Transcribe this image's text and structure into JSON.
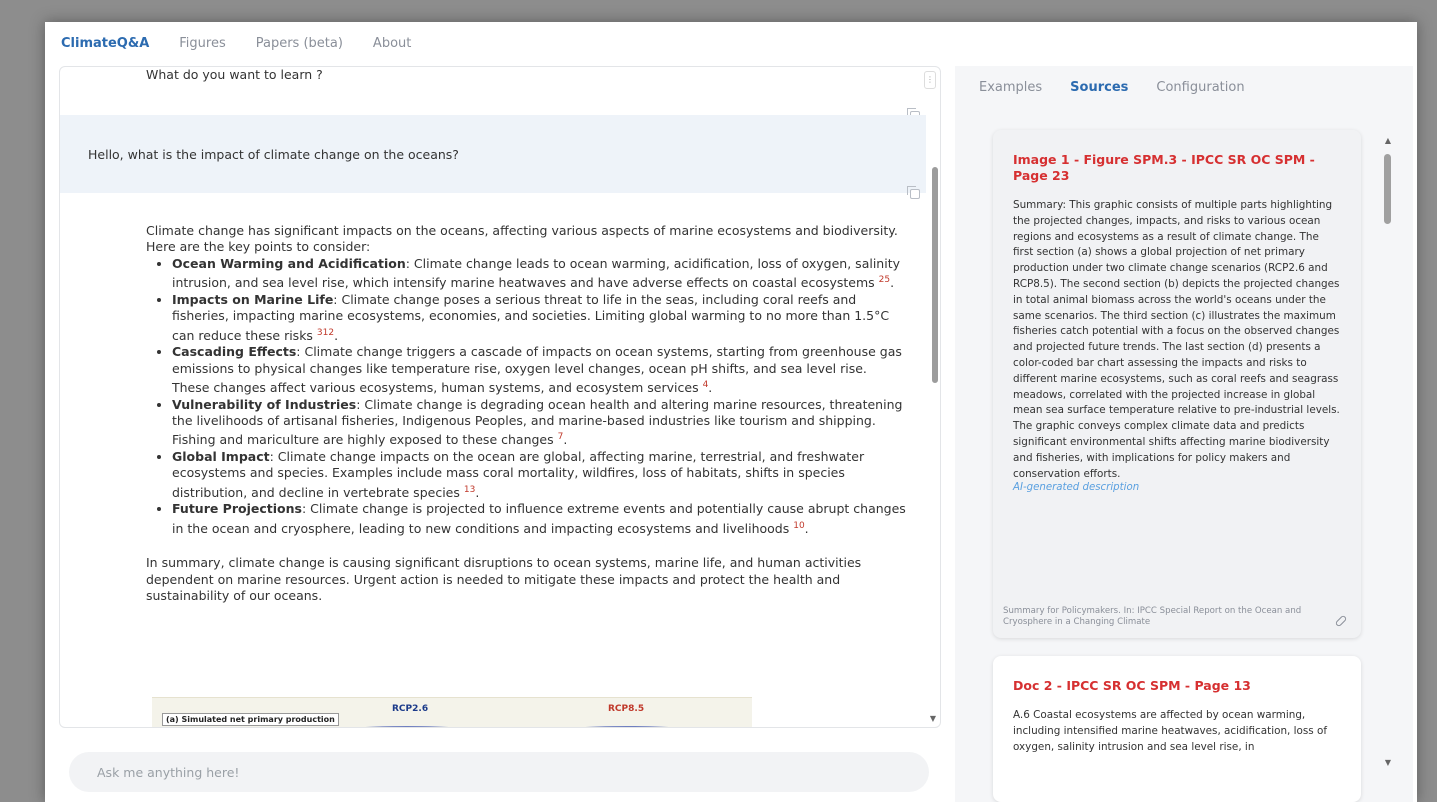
{
  "nav": {
    "items": [
      "ClimateQ&A",
      "Figures",
      "Papers (beta)",
      "About"
    ]
  },
  "chat": {
    "prev_question": "What do you want to learn ?",
    "user_message": "Hello, what is the impact of climate change on the oceans?",
    "answer_intro": "Climate change has significant impacts on the oceans, affecting various aspects of marine ecosystems and biodiversity. Here are the key points to consider:",
    "bullets": [
      {
        "title": "Ocean Warming and Acidification",
        "text": ": Climate change leads to ocean warming, acidification, loss of oxygen, salinity intrusion, and sea level rise, which intensify marine heatwaves and have adverse effects on coastal ecosystems ",
        "ref": "25",
        "end": "."
      },
      {
        "title": "Impacts on Marine Life",
        "text": ": Climate change poses a serious threat to life in the seas, including coral reefs and fisheries, impacting marine ecosystems, economies, and societies. Limiting global warming to no more than 1.5°C can reduce these risks ",
        "ref": "312",
        "end": "."
      },
      {
        "title": "Cascading Effects",
        "text": ": Climate change triggers a cascade of impacts on ocean systems, starting from greenhouse gas emissions to physical changes like temperature rise, oxygen level changes, ocean pH shifts, and sea level rise. These changes affect various ecosystems, human systems, and ecosystem services ",
        "ref": "4",
        "end": "."
      },
      {
        "title": "Vulnerability of Industries",
        "text": ": Climate change is degrading ocean health and altering marine resources, threatening the livelihoods of artisanal fisheries, Indigenous Peoples, and marine-based industries like tourism and shipping. Fishing and mariculture are highly exposed to these changes ",
        "ref": "7",
        "end": "."
      },
      {
        "title": "Global Impact",
        "text": ": Climate change impacts on the ocean are global, affecting marine, terrestrial, and freshwater ecosystems and species. Examples include mass coral mortality, wildfires, loss of habitats, shifts in species distribution, and decline in vertebrate species ",
        "ref": "13",
        "end": "."
      },
      {
        "title": "Future Projections",
        "text": ": Climate change is projected to influence extreme events and potentially cause abrupt changes in the ocean and cryosphere, leading to new conditions and impacting ecosystems and livelihoods ",
        "ref": "10",
        "end": "."
      }
    ],
    "answer_summary": "In summary, climate change is causing significant disruptions to ocean systems, marine life, and human activities dependent on marine resources. Urgent action is needed to mitigate these impacts and protect the health and sustainability of our oceans.",
    "figure": {
      "panel_label": "(a) Simulated net primary production",
      "left_label": "RCP2.6",
      "right_label": "RCP8.5"
    },
    "input_placeholder": "Ask me anything here!"
  },
  "right": {
    "tabs": [
      "Examples",
      "Sources",
      "Configuration"
    ],
    "cards": [
      {
        "title": "Image 1 - Figure SPM.3 - IPCC SR OC SPM - Page 23",
        "body": "Summary: This graphic consists of multiple parts highlighting the projected changes, impacts, and risks to various ocean regions and ecosystems as a result of climate change. The first section (a) shows a global projection of net primary production under two climate change scenarios (RCP2.6 and RCP8.5). The second section (b) depicts the projected changes in total animal biomass across the world's oceans under the same scenarios. The third section (c) illustrates the maximum fisheries catch potential with a focus on the observed changes and projected future trends. The last section (d) presents a color-coded bar chart assessing the impacts and risks to different marine ecosystems, such as coral reefs and seagrass meadows, correlated with the projected increase in global mean sea surface temperature relative to pre-industrial levels. The graphic conveys complex climate data and predicts significant environmental shifts affecting marine biodiversity and fisheries, with implications for policy makers and conservation efforts.",
        "note": "AI-generated description",
        "footer": "Summary for Policymakers. In: IPCC Special Report on the Ocean and Cryosphere in a Changing Climate"
      },
      {
        "title": "Doc 2 - IPCC SR OC SPM - Page 13",
        "body": "A.6 Coastal ecosystems are affected by ocean warming, including intensified marine heatwaves, acidification, loss of oxygen, salinity intrusion and sea level rise, in"
      }
    ]
  }
}
